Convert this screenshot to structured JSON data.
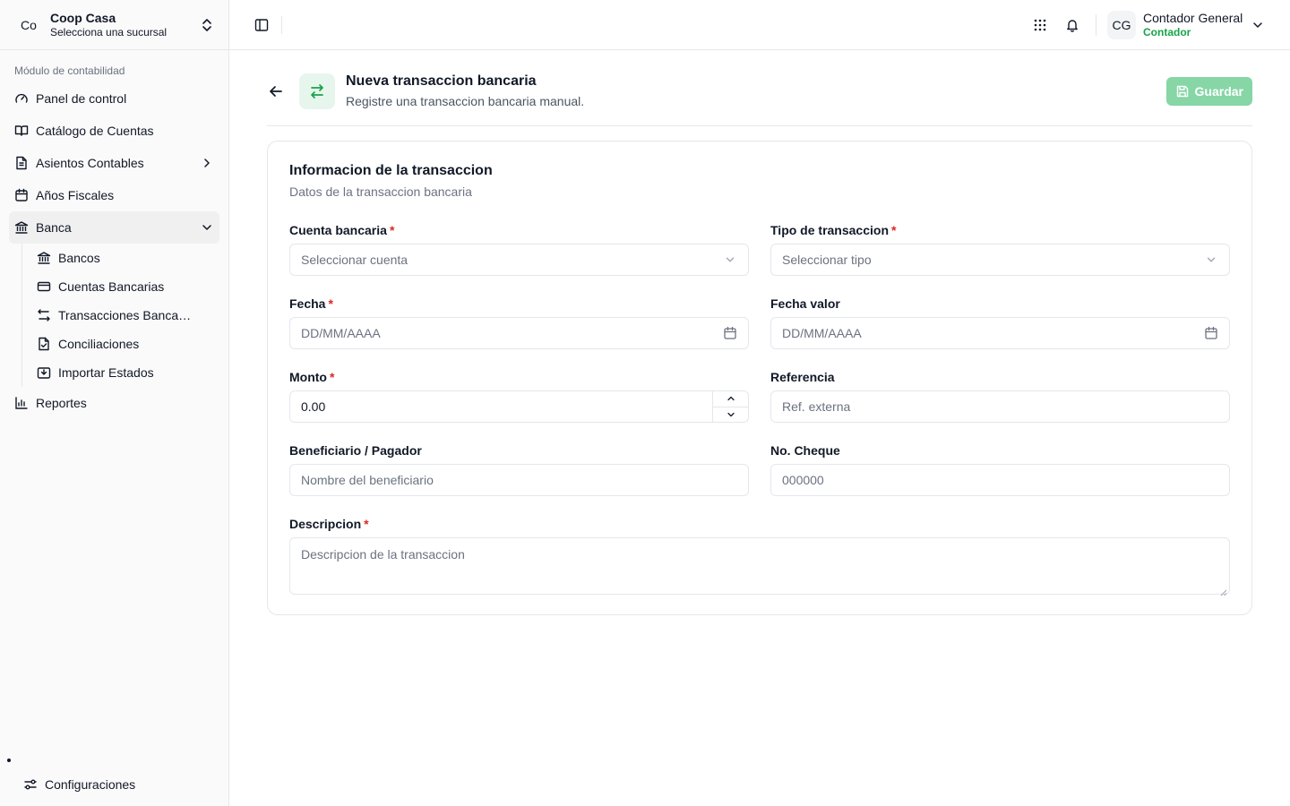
{
  "brand": {
    "logo": "Co",
    "name": "Coop Casa",
    "subtitle": "Selecciona una sucursal"
  },
  "sidebar": {
    "section_label": "Módulo de contabilidad",
    "items": [
      {
        "label": "Panel de control",
        "icon": "gauge-icon"
      },
      {
        "label": "Catálogo de Cuentas",
        "icon": "book-icon"
      },
      {
        "label": "Asientos Contables",
        "icon": "document-icon",
        "chevron": "right"
      },
      {
        "label": "Años Fiscales",
        "icon": "calendar-icon"
      },
      {
        "label": "Banca",
        "icon": "bank-icon",
        "chevron": "down",
        "active": true
      }
    ],
    "banca_sub": [
      {
        "label": "Bancos",
        "icon": "bank-icon"
      },
      {
        "label": "Cuentas Bancarias",
        "icon": "credit-card-icon"
      },
      {
        "label": "Transacciones Bancarias",
        "icon": "arrows-swap-icon"
      },
      {
        "label": "Conciliaciones",
        "icon": "file-check-icon"
      },
      {
        "label": "Importar Estados",
        "icon": "import-icon"
      }
    ],
    "reports": {
      "label": "Reportes",
      "icon": "bar-chart-icon"
    },
    "settings": {
      "label": "Configuraciones",
      "icon": "settings-sliders-icon"
    }
  },
  "topbar": {
    "user": {
      "initials": "CG",
      "name": "Contador General",
      "role": "Contador"
    }
  },
  "header": {
    "title": "Nueva transaccion bancaria",
    "subtitle": "Registre una transaccion bancaria manual.",
    "save_label": "Guardar"
  },
  "card": {
    "title": "Informacion de la transaccion",
    "subtitle": "Datos de la transaccion bancaria"
  },
  "form": {
    "cuenta": {
      "label": "Cuenta bancaria",
      "placeholder": "Seleccionar cuenta"
    },
    "tipo": {
      "label": "Tipo de transaccion",
      "placeholder": "Seleccionar tipo"
    },
    "fecha": {
      "label": "Fecha",
      "placeholder": "DD/MM/AAAA"
    },
    "fecha_valor": {
      "label": "Fecha valor",
      "placeholder": "DD/MM/AAAA"
    },
    "monto": {
      "label": "Monto",
      "value": "0.00"
    },
    "referencia": {
      "label": "Referencia",
      "placeholder": "Ref. externa"
    },
    "beneficiario": {
      "label": "Beneficiario / Pagador",
      "placeholder": "Nombre del beneficiario"
    },
    "cheque": {
      "label": "No. Cheque",
      "placeholder": "000000"
    },
    "descripcion": {
      "label": "Descripcion",
      "placeholder": "Descripcion de la transaccion"
    },
    "required_mark": "*"
  },
  "colors": {
    "accent": "#16a34a",
    "accent_soft": "#e7f6ec",
    "save_disabled": "#86d6a6",
    "required": "#dc2626"
  }
}
